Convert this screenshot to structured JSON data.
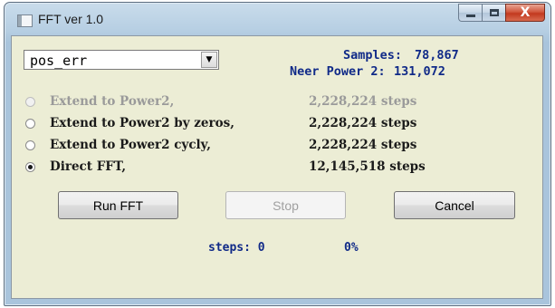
{
  "window": {
    "title": "FFT ver 1.0",
    "icon": "app-window-icon"
  },
  "controls": {
    "minimize_icon": "minimize-icon",
    "maximize_icon": "maximize-icon",
    "close_icon": "close-icon",
    "close_glyph": "X"
  },
  "source_select": {
    "value": "pos_err",
    "arrow": "▼"
  },
  "info": {
    "samples_label": "Samples:",
    "samples_value": "78,867",
    "power2_label": "Neer Power 2:",
    "power2_value": "131,072"
  },
  "options": [
    {
      "label": "Extend to Power2,",
      "steps": "2,228,224 steps",
      "enabled": false,
      "checked": false
    },
    {
      "label": "Extend to Power2 by zeros,",
      "steps": "2,228,224 steps",
      "enabled": true,
      "checked": false
    },
    {
      "label": "Extend to Power2 cycly,",
      "steps": "2,228,224 steps",
      "enabled": true,
      "checked": false
    },
    {
      "label": "Direct FFT,",
      "steps": "12,145,518 steps",
      "enabled": true,
      "checked": true
    }
  ],
  "buttons": {
    "run": "Run FFT",
    "stop": "Stop",
    "cancel": "Cancel"
  },
  "status": {
    "steps_text": "steps: 0",
    "percent_text": "0%"
  },
  "colors": {
    "client_bg": "#ecedd5",
    "info_text": "#102a88",
    "close_red": "#c2391f"
  }
}
